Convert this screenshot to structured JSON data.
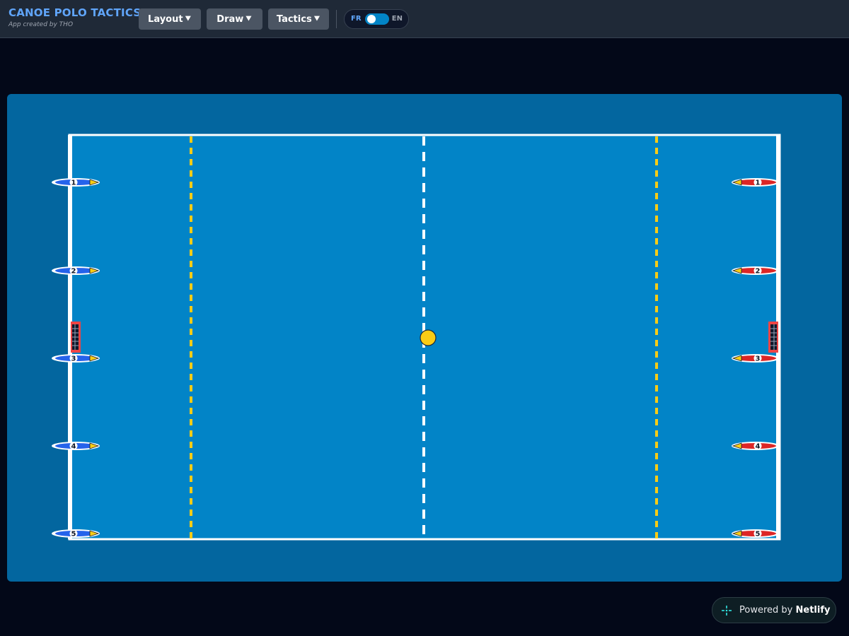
{
  "app": {
    "title": "CANOE POLO TACTICS",
    "subtitle": "App created by THO"
  },
  "menu": {
    "layout_label": "Layout",
    "draw_label": "Draw",
    "tactics_label": "Tactics",
    "caret": "⯆"
  },
  "language": {
    "fr_label": "FR",
    "en_label": "EN",
    "selected": "FR"
  },
  "field": {
    "team_blue_numbers": [
      "1",
      "2",
      "3",
      "4",
      "5"
    ],
    "team_red_numbers": [
      "1",
      "2",
      "3",
      "4",
      "5"
    ],
    "colors": {
      "pool": "#03669f",
      "water": "#0284c7",
      "boundary": "#ffffff",
      "six_metre_line": "#facc15",
      "centre_line": "#ffffff",
      "team_blue": "#2563eb",
      "team_red": "#dc2626",
      "ball": "#facc15",
      "goal": "#ef4444"
    }
  },
  "footer": {
    "powered_prefix": "Powered by",
    "powered_brand": "Netlify",
    "icon": "netlify-logo-icon"
  }
}
